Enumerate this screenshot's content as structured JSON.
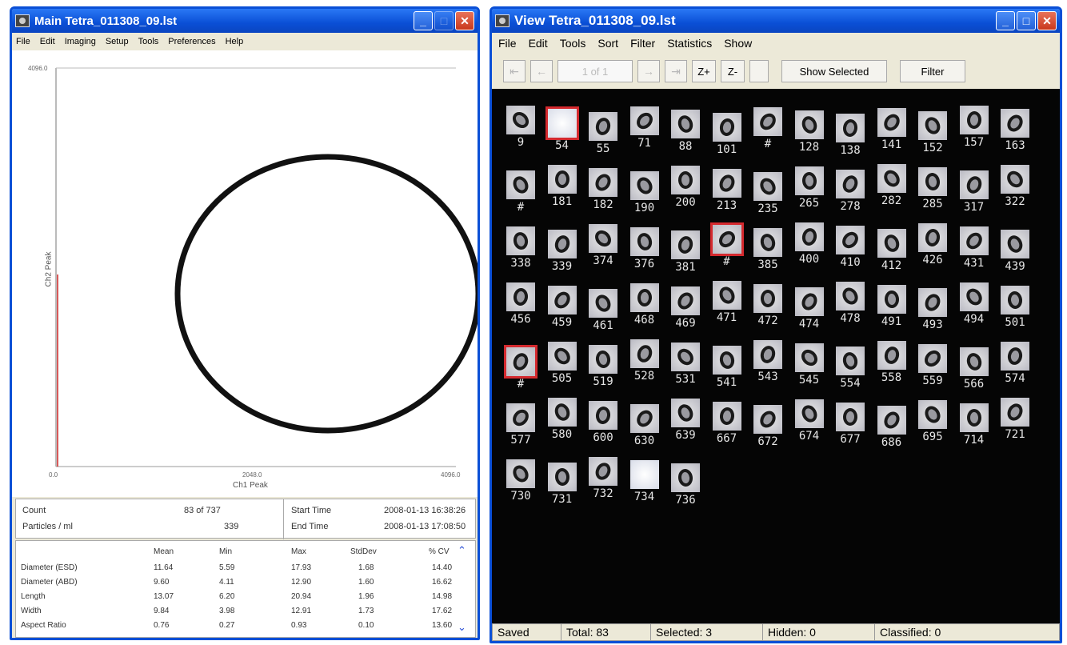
{
  "main": {
    "title": "Main  Tetra_011308_09.lst",
    "menu": [
      "File",
      "Edit",
      "Imaging",
      "Setup",
      "Tools",
      "Preferences",
      "Help"
    ],
    "plot": {
      "y_max_label": "4096.0",
      "y_min_label": "0.0",
      "x_mid_label": "2048.0",
      "x_max_label": "4096.0",
      "xlabel": "Ch1 Peak",
      "ylabel": "Ch2 Peak"
    },
    "stats_summary": {
      "count_label": "Count",
      "count_value": "83  of  737",
      "particles_label": "Particles / ml",
      "particles_value": "339",
      "start_label": "Start Time",
      "start_value": "2008-01-13  16:38:26",
      "end_label": "End Time",
      "end_value": "2008-01-13  17:08:50"
    },
    "stats_table": {
      "headers": [
        "Mean",
        "Min",
        "Max",
        "StdDev",
        "% CV"
      ],
      "rows": [
        {
          "name": "Diameter (ESD)",
          "values": [
            "11.64",
            "5.59",
            "17.93",
            "1.68",
            "14.40"
          ]
        },
        {
          "name": "Diameter (ABD)",
          "values": [
            "9.60",
            "4.11",
            "12.90",
            "1.60",
            "16.62"
          ]
        },
        {
          "name": "Length",
          "values": [
            "13.07",
            "6.20",
            "20.94",
            "1.96",
            "14.98"
          ]
        },
        {
          "name": "Width",
          "values": [
            "9.84",
            "3.98",
            "12.91",
            "1.73",
            "17.62"
          ]
        },
        {
          "name": "Aspect Ratio",
          "values": [
            "0.76",
            "0.27",
            "0.93",
            "0.10",
            "13.60"
          ]
        }
      ]
    }
  },
  "view": {
    "title": "View  Tetra_011308_09.lst",
    "menu": [
      "File",
      "Edit",
      "Tools",
      "Sort",
      "Filter",
      "Statistics",
      "Show"
    ],
    "toolbar": {
      "page": "1 of 1",
      "z_plus": "Z+",
      "z_minus": "Z-",
      "show_selected": "Show Selected",
      "filter": "Filter"
    },
    "particles": [
      "9",
      "54",
      "55",
      "71",
      "88",
      "101",
      "#",
      "128",
      "138",
      "141",
      "152",
      "157",
      "163",
      "#",
      "181",
      "182",
      "190",
      "200",
      "213",
      "235",
      "265",
      "278",
      "282",
      "285",
      "317",
      "322",
      "338",
      "339",
      "374",
      "376",
      "381",
      "#",
      "385",
      "400",
      "410",
      "412",
      "426",
      "431",
      "439",
      "456",
      "459",
      "461",
      "468",
      "469",
      "471",
      "472",
      "474",
      "478",
      "491",
      "493",
      "494",
      "501",
      "#",
      "505",
      "519",
      "528",
      "531",
      "541",
      "543",
      "545",
      "554",
      "558",
      "559",
      "566",
      "574",
      "577",
      "580",
      "600",
      "630",
      "639",
      "667",
      "672",
      "674",
      "677",
      "686",
      "695",
      "714",
      "721",
      "730",
      "731",
      "732",
      "734",
      "736"
    ],
    "selected_particles": [
      "54",
      "#",
      "#"
    ],
    "status": {
      "saved": "Saved",
      "total": "Total: 83",
      "selected": "Selected: 3",
      "hidden": "Hidden: 0",
      "classified": "Classified: 0"
    }
  }
}
